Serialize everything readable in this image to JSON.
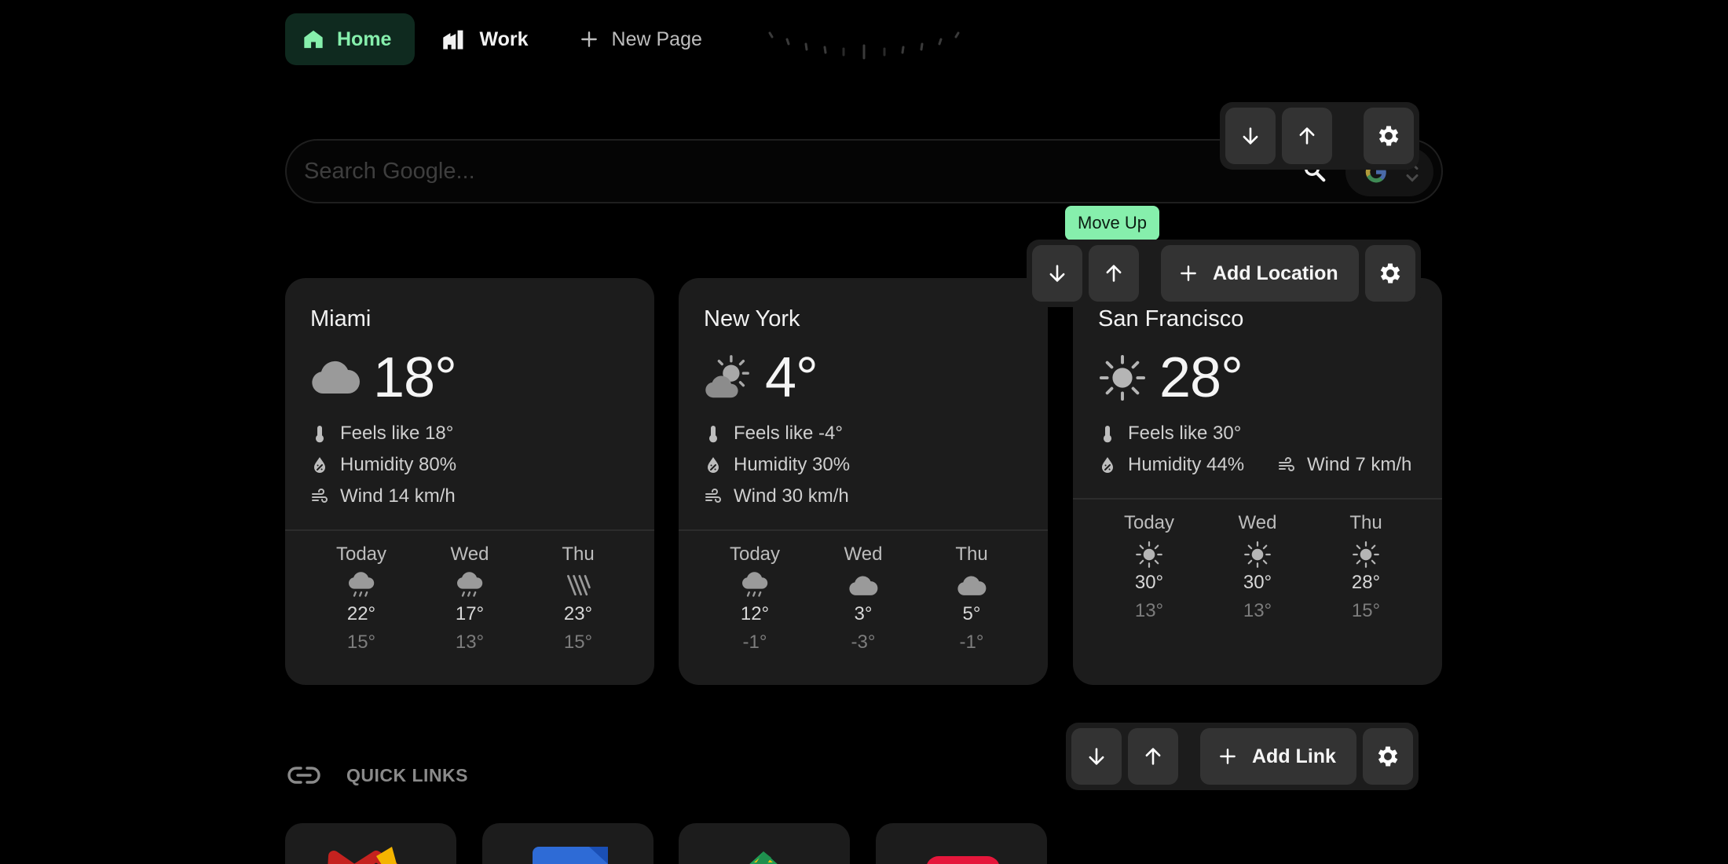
{
  "tabs": [
    {
      "label": "Home",
      "icon": "home-icon",
      "active": true
    },
    {
      "label": "Work",
      "icon": "office-icon",
      "active": false
    },
    {
      "label": "New Page",
      "icon": "plus-icon",
      "active": false
    }
  ],
  "search": {
    "placeholder": "Search Google...",
    "value": "",
    "engine_icon": "google-icon"
  },
  "toolbars": {
    "search": {
      "buttons": [
        "move-down",
        "move-up",
        "settings"
      ]
    },
    "weather": {
      "tooltip": "Move Up",
      "add_label": "Add Location"
    },
    "links": {
      "add_label": "Add Link"
    }
  },
  "weather": [
    {
      "city": "Miami",
      "icon": "cloud-icon",
      "temp": "18°",
      "feels": "Feels like 18°",
      "humidity": "Humidity 80%",
      "wind": "Wind 14 km/h",
      "forecast": [
        {
          "day": "Today",
          "icon": "rain-icon",
          "hi": "22°",
          "lo": "15°"
        },
        {
          "day": "Wed",
          "icon": "rain-icon",
          "hi": "17°",
          "lo": "13°"
        },
        {
          "day": "Thu",
          "icon": "heavy-rain-icon",
          "hi": "23°",
          "lo": "15°"
        }
      ]
    },
    {
      "city": "New York",
      "icon": "partly-sunny-icon",
      "temp": "4°",
      "feels": "Feels like -4°",
      "humidity": "Humidity 30%",
      "wind": "Wind 30 km/h",
      "forecast": [
        {
          "day": "Today",
          "icon": "rain-icon",
          "hi": "12°",
          "lo": "-1°"
        },
        {
          "day": "Wed",
          "icon": "cloud-icon",
          "hi": "3°",
          "lo": "-3°"
        },
        {
          "day": "Thu",
          "icon": "cloud-icon",
          "hi": "5°",
          "lo": "-1°"
        }
      ]
    },
    {
      "city": "San Francisco",
      "icon": "sun-icon",
      "temp": "28°",
      "feels": "Feels like 30°",
      "humidity": "Humidity 44%",
      "wind": "Wind 7 km/h",
      "forecast": [
        {
          "day": "Today",
          "icon": "sun-icon",
          "hi": "30°",
          "lo": "13°"
        },
        {
          "day": "Wed",
          "icon": "sun-icon",
          "hi": "30°",
          "lo": "13°"
        },
        {
          "day": "Thu",
          "icon": "sun-icon",
          "hi": "28°",
          "lo": "15°"
        }
      ]
    }
  ],
  "quick_links": {
    "title": "QUICK LINKS",
    "tiles": [
      "gmail-icon",
      "docs-icon",
      "drive-icon",
      "youtube-icon"
    ]
  },
  "colors": {
    "accent": "#86efac",
    "active_tab_bg": "#0f2a1f",
    "card_bg": "#1c1c1c",
    "button_bg": "#333333"
  }
}
